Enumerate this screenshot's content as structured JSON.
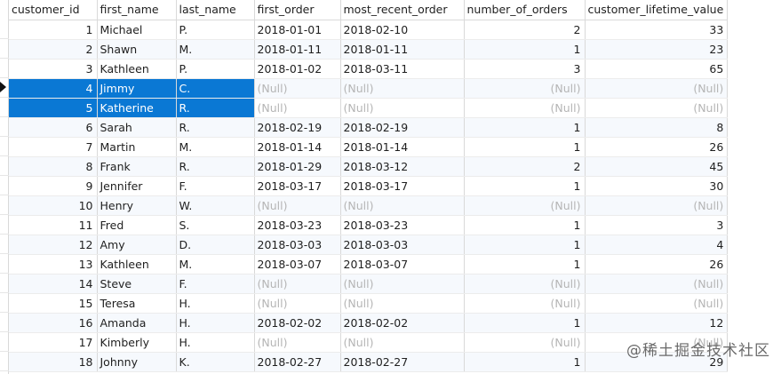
{
  "columns": [
    "customer_id",
    "first_name",
    "last_name",
    "first_order",
    "most_recent_order",
    "number_of_orders",
    "customer_lifetime_value"
  ],
  "rows": [
    {
      "customer_id": "1",
      "first_name": "Michael",
      "last_name": "P.",
      "first_order": "2018-01-01",
      "most_recent_order": "2018-02-10",
      "number_of_orders": "2",
      "customer_lifetime_value": "33"
    },
    {
      "customer_id": "2",
      "first_name": "Shawn",
      "last_name": "M.",
      "first_order": "2018-01-11",
      "most_recent_order": "2018-01-11",
      "number_of_orders": "1",
      "customer_lifetime_value": "23"
    },
    {
      "customer_id": "3",
      "first_name": "Kathleen",
      "last_name": "P.",
      "first_order": "2018-01-02",
      "most_recent_order": "2018-03-11",
      "number_of_orders": "3",
      "customer_lifetime_value": "65"
    },
    {
      "customer_id": "4",
      "first_name": "Jimmy",
      "last_name": "C.",
      "first_order": "(Null)",
      "most_recent_order": "(Null)",
      "number_of_orders": "(Null)",
      "customer_lifetime_value": "(Null)"
    },
    {
      "customer_id": "5",
      "first_name": "Katherine",
      "last_name": "R.",
      "first_order": "(Null)",
      "most_recent_order": "(Null)",
      "number_of_orders": "(Null)",
      "customer_lifetime_value": "(Null)"
    },
    {
      "customer_id": "6",
      "first_name": "Sarah",
      "last_name": "R.",
      "first_order": "2018-02-19",
      "most_recent_order": "2018-02-19",
      "number_of_orders": "1",
      "customer_lifetime_value": "8"
    },
    {
      "customer_id": "7",
      "first_name": "Martin",
      "last_name": "M.",
      "first_order": "2018-01-14",
      "most_recent_order": "2018-01-14",
      "number_of_orders": "1",
      "customer_lifetime_value": "26"
    },
    {
      "customer_id": "8",
      "first_name": "Frank",
      "last_name": "R.",
      "first_order": "2018-01-29",
      "most_recent_order": "2018-03-12",
      "number_of_orders": "2",
      "customer_lifetime_value": "45"
    },
    {
      "customer_id": "9",
      "first_name": "Jennifer",
      "last_name": "F.",
      "first_order": "2018-03-17",
      "most_recent_order": "2018-03-17",
      "number_of_orders": "1",
      "customer_lifetime_value": "30"
    },
    {
      "customer_id": "10",
      "first_name": "Henry",
      "last_name": "W.",
      "first_order": "(Null)",
      "most_recent_order": "(Null)",
      "number_of_orders": "(Null)",
      "customer_lifetime_value": "(Null)"
    },
    {
      "customer_id": "11",
      "first_name": "Fred",
      "last_name": "S.",
      "first_order": "2018-03-23",
      "most_recent_order": "2018-03-23",
      "number_of_orders": "1",
      "customer_lifetime_value": "3"
    },
    {
      "customer_id": "12",
      "first_name": "Amy",
      "last_name": "D.",
      "first_order": "2018-03-03",
      "most_recent_order": "2018-03-03",
      "number_of_orders": "1",
      "customer_lifetime_value": "4"
    },
    {
      "customer_id": "13",
      "first_name": "Kathleen",
      "last_name": "M.",
      "first_order": "2018-03-07",
      "most_recent_order": "2018-03-07",
      "number_of_orders": "1",
      "customer_lifetime_value": "26"
    },
    {
      "customer_id": "14",
      "first_name": "Steve",
      "last_name": "F.",
      "first_order": "(Null)",
      "most_recent_order": "(Null)",
      "number_of_orders": "(Null)",
      "customer_lifetime_value": "(Null)"
    },
    {
      "customer_id": "15",
      "first_name": "Teresa",
      "last_name": "H.",
      "first_order": "(Null)",
      "most_recent_order": "(Null)",
      "number_of_orders": "(Null)",
      "customer_lifetime_value": "(Null)"
    },
    {
      "customer_id": "16",
      "first_name": "Amanda",
      "last_name": "H.",
      "first_order": "2018-02-02",
      "most_recent_order": "2018-02-02",
      "number_of_orders": "1",
      "customer_lifetime_value": "12"
    },
    {
      "customer_id": "17",
      "first_name": "Kimberly",
      "last_name": "H.",
      "first_order": "(Null)",
      "most_recent_order": "(Null)",
      "number_of_orders": "(Null)",
      "customer_lifetime_value": "(Null)"
    },
    {
      "customer_id": "18",
      "first_name": "Johnny",
      "last_name": "K.",
      "first_order": "2018-02-27",
      "most_recent_order": "2018-02-27",
      "number_of_orders": "1",
      "customer_lifetime_value": "29"
    }
  ],
  "selected_customer_ids": [
    "4",
    "5"
  ],
  "current_row_customer_id": "4",
  "watermark": "@稀土掘金技术社区",
  "colors": {
    "selection": "#0a78d4",
    "null_text": "#b5b5b5",
    "alt_row": "#f6f9fd"
  }
}
